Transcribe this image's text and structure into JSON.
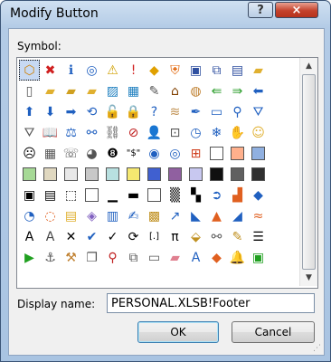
{
  "window": {
    "title": "Modify Button"
  },
  "titlebar": {
    "help_label": "?",
    "close_label": "×"
  },
  "symbol_label": "Symbol:",
  "symbols": [
    {
      "name": "org-chart-icon",
      "glyph": "⬡",
      "color": "#d08000",
      "selected": true
    },
    {
      "name": "error-icon",
      "glyph": "✖",
      "color": "#d02020"
    },
    {
      "name": "info-icon",
      "glyph": "ℹ",
      "color": "#2060c0"
    },
    {
      "name": "target-icon",
      "glyph": "◎",
      "color": "#2060c0"
    },
    {
      "name": "warning-icon",
      "glyph": "⚠",
      "color": "#d0a000"
    },
    {
      "name": "exclamation-icon",
      "glyph": "!",
      "color": "#d02020"
    },
    {
      "name": "diamond-warning-icon",
      "glyph": "◆",
      "color": "#e0a000"
    },
    {
      "name": "shield-icon",
      "glyph": "⛨",
      "color": "#e06000"
    },
    {
      "name": "save-icon",
      "glyph": "▣",
      "color": "#3050a0"
    },
    {
      "name": "save-all-icon",
      "glyph": "⧉",
      "color": "#3050a0"
    },
    {
      "name": "save-as-icon",
      "glyph": "▤",
      "color": "#3050a0"
    },
    {
      "name": "folder-icon",
      "glyph": "▰",
      "color": "#e0b030"
    },
    {
      "name": "blank-cell",
      "glyph": ""
    },
    {
      "name": "new-document-icon",
      "glyph": "▯",
      "color": "#555"
    },
    {
      "name": "open-folder-icon",
      "glyph": "▰",
      "color": "#e0b030"
    },
    {
      "name": "folder-new-icon",
      "glyph": "▰",
      "color": "#d0a020"
    },
    {
      "name": "folder-open-icon",
      "glyph": "▰",
      "color": "#e0b030"
    },
    {
      "name": "image-icon",
      "glyph": "▨",
      "color": "#2080c0"
    },
    {
      "name": "picture-icon",
      "glyph": "▦",
      "color": "#2080c0"
    },
    {
      "name": "document-edit-icon",
      "glyph": "✎",
      "color": "#555"
    },
    {
      "name": "home-icon",
      "glyph": "⌂",
      "color": "#804000"
    },
    {
      "name": "palette-icon",
      "glyph": "◍",
      "color": "#c08030"
    },
    {
      "name": "back-arrows-icon",
      "glyph": "⇚",
      "color": "#30a030"
    },
    {
      "name": "forward-arrows-icon",
      "glyph": "⇛",
      "color": "#30a030"
    },
    {
      "name": "arrow-left-icon",
      "glyph": "⬅",
      "color": "#2060c0"
    },
    {
      "name": "blank-cell",
      "glyph": ""
    },
    {
      "name": "arrow-up-icon",
      "glyph": "⬆",
      "color": "#2060c0"
    },
    {
      "name": "arrow-down-icon",
      "glyph": "⬇",
      "color": "#2060c0"
    },
    {
      "name": "arrow-right-icon",
      "glyph": "➡",
      "color": "#2060c0"
    },
    {
      "name": "circle-back-icon",
      "glyph": "⟲",
      "color": "#2060c0"
    },
    {
      "name": "lock-open-icon",
      "glyph": "🔓",
      "color": "#c09020"
    },
    {
      "name": "lock-icon",
      "glyph": "🔒",
      "color": "#c09020"
    },
    {
      "name": "question-icon",
      "glyph": "?",
      "color": "#2060c0"
    },
    {
      "name": "scroll-icon",
      "glyph": "≋",
      "color": "#c09050"
    },
    {
      "name": "pen-icon",
      "glyph": "✒",
      "color": "#2060c0"
    },
    {
      "name": "screen-icon",
      "glyph": "▭",
      "color": "#2060c0"
    },
    {
      "name": "magnifier-icon",
      "glyph": "⚲",
      "color": "#2060c0"
    },
    {
      "name": "filter-icon",
      "glyph": "⛛",
      "color": "#2060c0"
    },
    {
      "name": "blank-cell",
      "glyph": ""
    },
    {
      "name": "funnel-icon",
      "glyph": "⛛",
      "color": "#555"
    },
    {
      "name": "book-icon",
      "glyph": "📖",
      "color": "#555"
    },
    {
      "name": "scales-icon",
      "glyph": "⚖",
      "color": "#2060c0"
    },
    {
      "name": "binoculars-icon",
      "glyph": "⚯",
      "color": "#2060c0"
    },
    {
      "name": "link-icon",
      "glyph": "⛓",
      "color": "#555"
    },
    {
      "name": "no-symbol-icon",
      "glyph": "⊘",
      "color": "#c02020"
    },
    {
      "name": "person-icon",
      "glyph": "👤",
      "color": "#555"
    },
    {
      "name": "flowchart-icon",
      "glyph": "⊡",
      "color": "#555"
    },
    {
      "name": "clock-icon",
      "glyph": "◷",
      "color": "#2060c0"
    },
    {
      "name": "snowflake-icon",
      "glyph": "❄",
      "color": "#2060c0"
    },
    {
      "name": "hand-icon",
      "glyph": "✋",
      "color": "#e0b030"
    },
    {
      "name": "smiley-icon",
      "glyph": "☺",
      "color": "#e0b030"
    },
    {
      "name": "blank-cell",
      "glyph": ""
    },
    {
      "name": "sad-face-icon",
      "glyph": "☹",
      "color": "#000"
    },
    {
      "name": "calculator-icon",
      "glyph": "▦",
      "color": "#555"
    },
    {
      "name": "phone-icon",
      "glyph": "☏",
      "color": "#555"
    },
    {
      "name": "piggy-bank-icon",
      "glyph": "◕",
      "color": "#555"
    },
    {
      "name": "eight-ball-icon",
      "glyph": "❽",
      "color": "#000"
    },
    {
      "name": "dollar-quote-icon",
      "glyph": "\"$\"",
      "color": "#000"
    },
    {
      "name": "eye-icon",
      "glyph": "◉",
      "color": "#2060c0"
    },
    {
      "name": "lens-icon",
      "glyph": "◎",
      "color": "#2060c0"
    },
    {
      "name": "windows-flag-icon",
      "glyph": "⊞",
      "color": "#d04020"
    },
    {
      "name": "swatch-white",
      "swatch": "#ffffff"
    },
    {
      "name": "swatch-peach",
      "swatch": "#ffb08c"
    },
    {
      "name": "swatch-light-blue",
      "swatch": "#90b0e0"
    },
    {
      "name": "blank-cell",
      "glyph": ""
    },
    {
      "name": "swatch-green",
      "swatch": "#a6d996"
    },
    {
      "name": "swatch-beige",
      "swatch": "#e0d8c0"
    },
    {
      "name": "swatch-light-gray",
      "swatch": "#e8e8e8"
    },
    {
      "name": "swatch-gray",
      "swatch": "#c8c8c8"
    },
    {
      "name": "swatch-aqua",
      "swatch": "#b8e0e0"
    },
    {
      "name": "swatch-yellow",
      "swatch": "#f5e870"
    },
    {
      "name": "swatch-blue",
      "swatch": "#4060d0"
    },
    {
      "name": "swatch-purple",
      "swatch": "#9060a0"
    },
    {
      "name": "swatch-lavender",
      "swatch": "#c8c8f0"
    },
    {
      "name": "swatch-black",
      "swatch": "#101010"
    },
    {
      "name": "swatch-half-black",
      "swatch": "#606060"
    },
    {
      "name": "swatch-dark",
      "swatch": "#303030"
    },
    {
      "name": "blank-cell",
      "glyph": ""
    },
    {
      "name": "border-thick-icon",
      "glyph": "▣",
      "color": "#000"
    },
    {
      "name": "border-double-icon",
      "glyph": "▤",
      "color": "#000"
    },
    {
      "name": "border-dotted-icon",
      "glyph": "⬚",
      "color": "#000"
    },
    {
      "name": "swatch-outline-white",
      "swatch": "#ffffff"
    },
    {
      "name": "border-bottom-icon",
      "glyph": "▁",
      "color": "#000"
    },
    {
      "name": "border-bottom-thick-icon",
      "glyph": "▬",
      "color": "#000"
    },
    {
      "name": "swatch-plain",
      "swatch": "#ffffff"
    },
    {
      "name": "shade-icon",
      "glyph": "▒",
      "color": "#000"
    },
    {
      "name": "checker-icon",
      "glyph": "▚",
      "color": "#000"
    },
    {
      "name": "circle-arrow-icon",
      "glyph": "➲",
      "color": "#2060c0"
    },
    {
      "name": "bar-chart-icon",
      "glyph": "▟",
      "color": "#e06020"
    },
    {
      "name": "drop-icon",
      "glyph": "◆",
      "color": "#2060c0"
    },
    {
      "name": "blank-cell",
      "glyph": ""
    },
    {
      "name": "pie-chart-icon",
      "glyph": "◔",
      "color": "#2060c0"
    },
    {
      "name": "donut-chart-icon",
      "glyph": "◌",
      "color": "#e06020"
    },
    {
      "name": "stack-icon",
      "glyph": "▤",
      "color": "#e0b030"
    },
    {
      "name": "cube-icon",
      "glyph": "◈",
      "color": "#8060c0"
    },
    {
      "name": "books-icon",
      "glyph": "▥",
      "color": "#2060c0"
    },
    {
      "name": "edit-icon",
      "glyph": "✍",
      "color": "#2060c0"
    },
    {
      "name": "paste-icon",
      "glyph": "▩",
      "color": "#c09020"
    },
    {
      "name": "chart-up-icon",
      "glyph": "↗",
      "color": "#2060c0"
    },
    {
      "name": "area-chart-icon",
      "glyph": "◣",
      "color": "#2060c0"
    },
    {
      "name": "mountain-icon",
      "glyph": "▲",
      "color": "#e06020"
    },
    {
      "name": "area-icon",
      "glyph": "◢",
      "color": "#2060c0"
    },
    {
      "name": "wave-chart-icon",
      "glyph": "≈",
      "color": "#e06020"
    },
    {
      "name": "blank-cell",
      "glyph": ""
    },
    {
      "name": "font-a-icon",
      "glyph": "A",
      "color": "#000"
    },
    {
      "name": "font-a-shadow-icon",
      "glyph": "A",
      "color": "#444"
    },
    {
      "name": "cross-icon",
      "glyph": "✕",
      "color": "#000"
    },
    {
      "name": "check-icon",
      "glyph": "✔",
      "color": "#2060c0"
    },
    {
      "name": "tick-icon",
      "glyph": "✓",
      "color": "#000"
    },
    {
      "name": "refresh-icon",
      "glyph": "⟳",
      "color": "#000"
    },
    {
      "name": "bracket-icon",
      "glyph": "[.]",
      "color": "#000"
    },
    {
      "name": "pi-icon",
      "glyph": "π",
      "color": "#000"
    },
    {
      "name": "paint-bucket-icon",
      "glyph": "⬙",
      "color": "#c09020"
    },
    {
      "name": "binoculars-find-icon",
      "glyph": "⚯",
      "color": "#555"
    },
    {
      "name": "brush-icon",
      "glyph": "✎",
      "color": "#c09020"
    },
    {
      "name": "list-icon",
      "glyph": "☰",
      "color": "#000"
    },
    {
      "name": "blank-cell",
      "glyph": ""
    },
    {
      "name": "play-icon",
      "glyph": "▶",
      "color": "#20a020"
    },
    {
      "name": "anchor-icon",
      "glyph": "⚓",
      "color": "#555"
    },
    {
      "name": "tools-icon",
      "glyph": "⚒",
      "color": "#c08030"
    },
    {
      "name": "copy-icon",
      "glyph": "❐",
      "color": "#555"
    },
    {
      "name": "paperclip-icon",
      "glyph": "⚲",
      "color": "#c02020"
    },
    {
      "name": "pages-icon",
      "glyph": "⧉",
      "color": "#555"
    },
    {
      "name": "page-icon",
      "glyph": "▭",
      "color": "#555"
    },
    {
      "name": "eraser-icon",
      "glyph": "▰",
      "color": "#e08090"
    },
    {
      "name": "text-a-icon",
      "glyph": "A",
      "color": "#2060c0"
    },
    {
      "name": "office-logo-icon",
      "glyph": "◆",
      "color": "#e06020"
    },
    {
      "name": "bell-icon",
      "glyph": "🔔",
      "color": "#e0b030"
    },
    {
      "name": "monitor-chart-icon",
      "glyph": "▣",
      "color": "#20a020"
    },
    {
      "name": "blank-cell",
      "glyph": ""
    }
  ],
  "display_name": {
    "label": "Display name:",
    "value": "PERSONAL.XLSB!Footer"
  },
  "buttons": {
    "ok": "OK",
    "cancel": "Cancel"
  },
  "scrollbar": {
    "up_arrow": "▲",
    "down_arrow": "▼"
  }
}
